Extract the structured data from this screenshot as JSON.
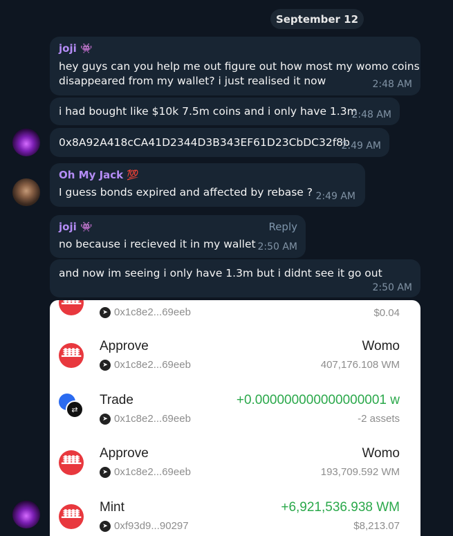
{
  "date_label": "September 12",
  "messages": [
    {
      "sender": "joji",
      "sender_emoji": "👾",
      "lines": [
        "hey guys can you help me out figure out how most my womo coins",
        "disappeared from my wallet? i just realised it now"
      ],
      "time": "2:48 AM"
    },
    {
      "lines": [
        "i had bought like $10k 7.5m coins and i only have 1.3m"
      ],
      "time": "2:48 AM"
    },
    {
      "lines": [
        "0x8A92A418cCA41D2344D3B343EF61D23CbDC32f8b"
      ],
      "time": "2:49 AM"
    },
    {
      "sender": "Oh My Jack",
      "sender_emoji": "💯",
      "lines": [
        "I guess bonds expired and affected by rebase ?"
      ],
      "time": "2:49 AM"
    },
    {
      "sender": "joji",
      "sender_emoji": "👾",
      "reply_label": "Reply",
      "lines": [
        "no because i recieved it in my wallet"
      ],
      "time": "2:50 AM"
    },
    {
      "lines": [
        "and now im seeing i only have 1.3m but i didnt see it go out"
      ],
      "time": "2:50 AM"
    }
  ],
  "wallet": {
    "rows": [
      {
        "title": "",
        "address": "0x1c8e2...69eeb",
        "right_top": "",
        "right_bottom": "$0.04"
      },
      {
        "title": "Approve",
        "address": "0x1c8e2...69eeb",
        "right_top": "Womo",
        "right_bottom": "407,176.108 WM"
      },
      {
        "title": "Trade",
        "address": "0x1c8e2...69eeb",
        "right_top": "+0.000000000000000001 w",
        "right_bottom": "-2 assets"
      },
      {
        "title": "Approve",
        "address": "0x1c8e2...69eeb",
        "right_top": "Womo",
        "right_bottom": "193,709.592 WM"
      },
      {
        "title": "Mint",
        "address": "0xf93d9...90297",
        "right_top": "+6,921,536.938 WM",
        "right_bottom": "$8,213.07"
      }
    ]
  },
  "colors": {
    "background": "#0e1621",
    "bubble": "#182533",
    "joji_name": "#b48cf5",
    "jack_name": "#b48cf5",
    "time": "#8193a5",
    "positive": "#2aa84a"
  }
}
